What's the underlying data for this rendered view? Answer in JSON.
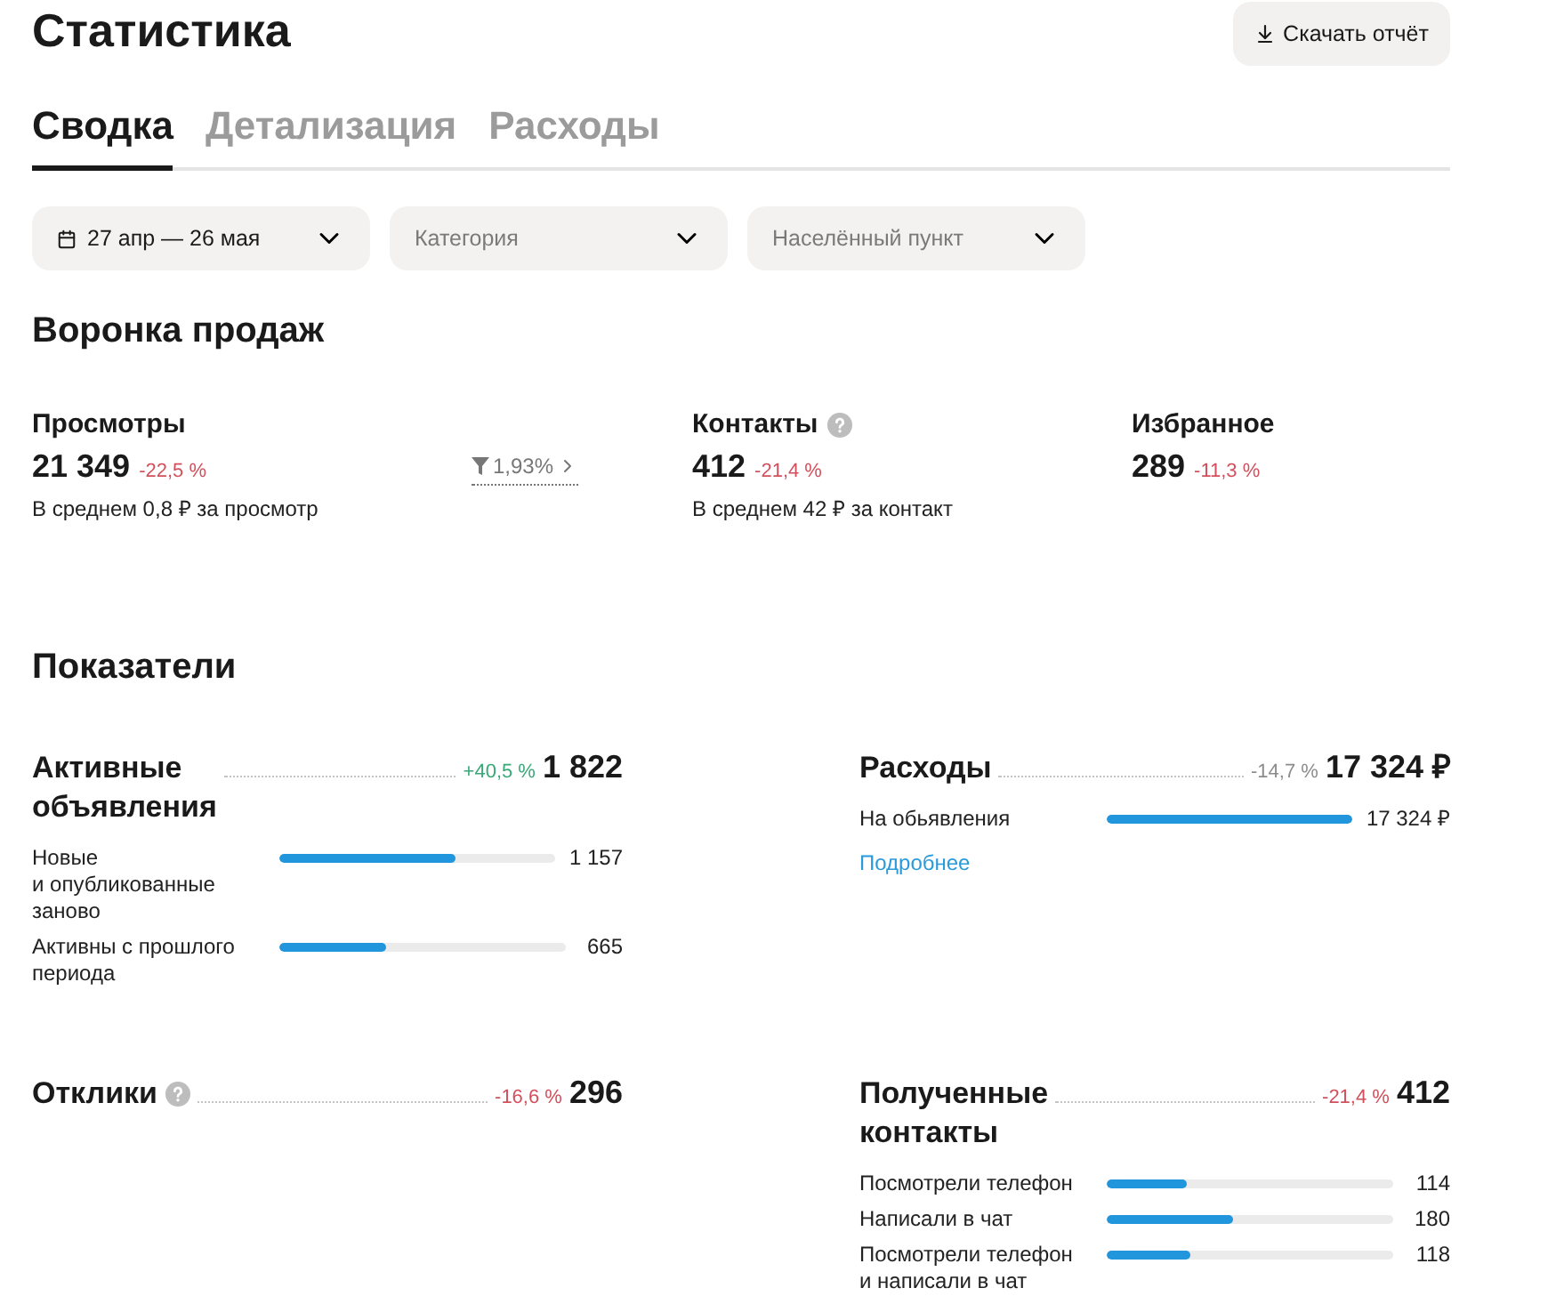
{
  "header": {
    "title": "Статистика",
    "download_button": "Скачать отчёт"
  },
  "tabs": [
    {
      "label": "Сводка",
      "selected": true
    },
    {
      "label": "Детализация",
      "selected": false
    },
    {
      "label": "Расходы",
      "selected": false
    }
  ],
  "filters": [
    {
      "kind": "date",
      "value": "27 апр — 26 мая"
    },
    {
      "kind": "select",
      "placeholder": "Категория"
    },
    {
      "kind": "select",
      "placeholder": "Населённый пункт"
    }
  ],
  "funnel": {
    "title": "Воронка продаж",
    "items": [
      {
        "kind": "stage",
        "label": "Просмотры",
        "info": false,
        "value": "21 349",
        "change": "-22,5 %",
        "color": "#d2505c",
        "note": "В среднем 0,8 ₽ за просмотр"
      },
      {
        "kind": "conversion",
        "value": "1,93%"
      },
      {
        "kind": "stage",
        "label": "Контакты",
        "info": true,
        "value": "412",
        "change": "-21,4 %",
        "color": "#d2505c",
        "note": "В среднем 42 ₽ за контакт"
      },
      {
        "kind": "stage",
        "label": "Избранное",
        "info": false,
        "value": "289",
        "change": "-11,3 %",
        "color": "#d2505c"
      }
    ]
  },
  "metrics": {
    "title": "Показатели",
    "cards": [
      {
        "title": "Активные объявления",
        "info": false,
        "change": "+40,5 %",
        "color": "#3aa877",
        "value": "1 822",
        "rows": [
          {
            "label": "Новые\nи опубликованные заново",
            "value": "1 157",
            "level": 0.64
          },
          {
            "label": "Активны с прошлого периода",
            "value": "665",
            "level": 0.37
          }
        ]
      },
      {
        "title": "Расходы",
        "info": false,
        "change": "-14,7 %",
        "color": "#8c8c8c",
        "value": "17 324 ₽",
        "rows": [
          {
            "label": "На обьявления",
            "value": "17 324 ₽",
            "level": 1
          }
        ],
        "link": "Подробнее"
      },
      {
        "title": "Отклики",
        "info": true,
        "change": "-16,6 %",
        "color": "#d2505c",
        "value": "296"
      },
      {
        "title": "Полученные контакты",
        "info": false,
        "change": "-21,4 %",
        "color": "#d2505c",
        "value": "412",
        "rows": [
          {
            "label": "Посмотрели телефон",
            "value": "114",
            "level": 0.28
          },
          {
            "label": "Написали в чат",
            "value": "180",
            "level": 0.44
          },
          {
            "label": "Посмотрели телефон\nи написали в чат",
            "value": "118",
            "level": 0.29
          }
        ]
      }
    ]
  }
}
